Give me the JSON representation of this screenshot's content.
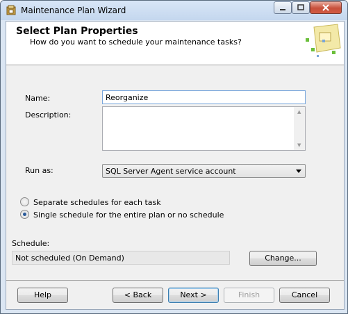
{
  "window": {
    "title": "Maintenance Plan Wizard"
  },
  "header": {
    "title": "Select Plan Properties",
    "subtitle": "How do you want to schedule your maintenance tasks?"
  },
  "form": {
    "name_label": "Name:",
    "name_value": "Reorganize",
    "description_label": "Description:",
    "description_value": "",
    "run_as_label": "Run as:",
    "run_as_value": "SQL Server Agent service account"
  },
  "options": {
    "separate_label": "Separate schedules for each task",
    "single_label": "Single schedule for the entire plan or no schedule",
    "selected": "single"
  },
  "schedule": {
    "label": "Schedule:",
    "value": "Not scheduled (On Demand)",
    "change_label": "Change..."
  },
  "footer": {
    "help": "Help",
    "back": "< Back",
    "next": "Next >",
    "finish": "Finish",
    "cancel": "Cancel"
  }
}
